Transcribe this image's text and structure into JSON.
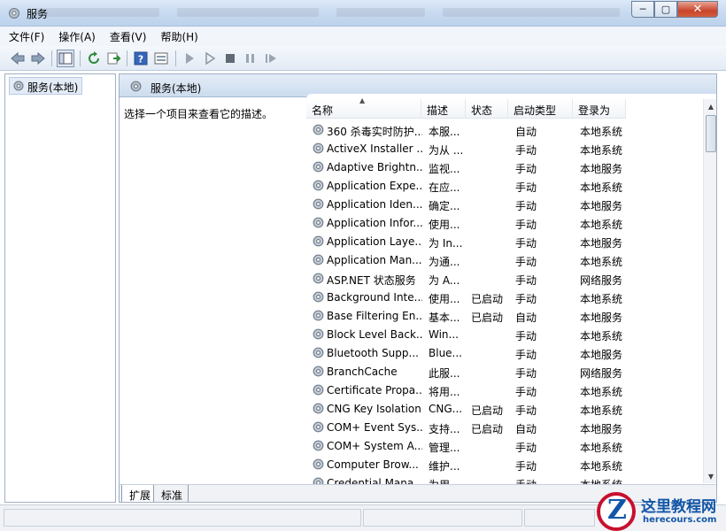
{
  "window": {
    "title": "服务",
    "controls": {
      "minimize": "─",
      "maximize": "▢",
      "close": "✕"
    }
  },
  "menu": [
    "文件(F)",
    "操作(A)",
    "查看(V)",
    "帮助(H)"
  ],
  "toolbar_icons": [
    "back-icon",
    "forward-icon",
    "show-tree-icon",
    "refresh-icon",
    "export-icon",
    "help-icon",
    "properties-icon",
    "start-icon",
    "start-alt-icon",
    "stop-icon",
    "pause-icon",
    "restart-icon"
  ],
  "tree": {
    "item": "服务(本地)"
  },
  "panel": {
    "header": "服务(本地)",
    "description": "选择一个项目来查看它的描述。"
  },
  "columns": [
    "名称",
    "描述",
    "状态",
    "启动类型",
    "登录为"
  ],
  "services": [
    {
      "name": "360 杀毒实时防护...",
      "desc": "本服...",
      "status": "",
      "start": "自动",
      "logon": "本地系统"
    },
    {
      "name": "ActiveX Installer ...",
      "desc": "为从 ...",
      "status": "",
      "start": "手动",
      "logon": "本地系统"
    },
    {
      "name": "Adaptive Brightn...",
      "desc": "监视...",
      "status": "",
      "start": "手动",
      "logon": "本地服务"
    },
    {
      "name": "Application Expe...",
      "desc": "在应...",
      "status": "",
      "start": "手动",
      "logon": "本地系统"
    },
    {
      "name": "Application Iden...",
      "desc": "确定...",
      "status": "",
      "start": "手动",
      "logon": "本地服务"
    },
    {
      "name": "Application Infor...",
      "desc": "使用...",
      "status": "",
      "start": "手动",
      "logon": "本地系统"
    },
    {
      "name": "Application Laye...",
      "desc": "为 In...",
      "status": "",
      "start": "手动",
      "logon": "本地服务"
    },
    {
      "name": "Application Man...",
      "desc": "为通...",
      "status": "",
      "start": "手动",
      "logon": "本地系统"
    },
    {
      "name": "ASP.NET 状态服务",
      "desc": "为 A...",
      "status": "",
      "start": "手动",
      "logon": "网络服务"
    },
    {
      "name": "Background Inte...",
      "desc": "使用...",
      "status": "已启动",
      "start": "手动",
      "logon": "本地系统"
    },
    {
      "name": "Base Filtering En...",
      "desc": "基本...",
      "status": "已启动",
      "start": "自动",
      "logon": "本地服务"
    },
    {
      "name": "Block Level Back...",
      "desc": "Win...",
      "status": "",
      "start": "手动",
      "logon": "本地系统"
    },
    {
      "name": "Bluetooth Supp...",
      "desc": "Blue...",
      "status": "",
      "start": "手动",
      "logon": "本地服务"
    },
    {
      "name": "BranchCache",
      "desc": "此服...",
      "status": "",
      "start": "手动",
      "logon": "网络服务"
    },
    {
      "name": "Certificate Propa...",
      "desc": "将用...",
      "status": "",
      "start": "手动",
      "logon": "本地系统"
    },
    {
      "name": "CNG Key Isolation",
      "desc": "CNG...",
      "status": "已启动",
      "start": "手动",
      "logon": "本地系统"
    },
    {
      "name": "COM+ Event Sys...",
      "desc": "支持...",
      "status": "已启动",
      "start": "自动",
      "logon": "本地服务"
    },
    {
      "name": "COM+ System A...",
      "desc": "管理...",
      "status": "",
      "start": "手动",
      "logon": "本地系统"
    },
    {
      "name": "Computer Brow...",
      "desc": "维护...",
      "status": "",
      "start": "手动",
      "logon": "本地系统"
    },
    {
      "name": "Credential Mana...",
      "desc": "为用...",
      "status": "",
      "start": "手动",
      "logon": "本地系统"
    }
  ],
  "tabs": [
    "扩展",
    "标准"
  ],
  "watermark": {
    "logo_letter": "Z",
    "name": "这里教程网",
    "url": "herecours.com"
  },
  "colors": {
    "accent": "#1356a8",
    "watermark_ring": "#c8102e"
  }
}
